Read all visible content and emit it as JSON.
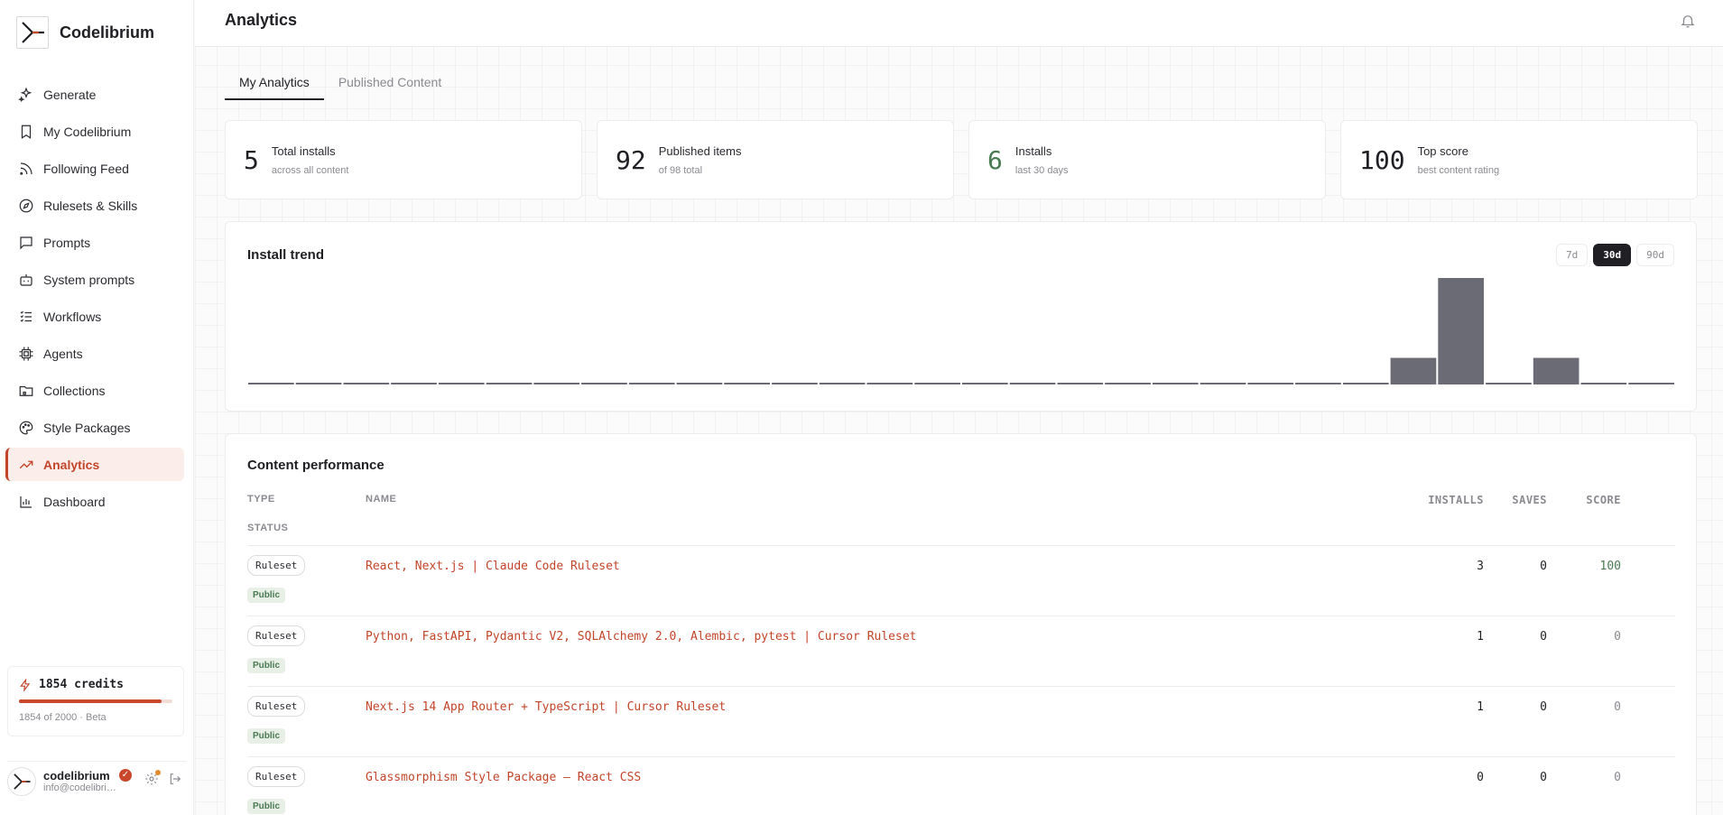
{
  "app": {
    "name": "Codelibrium"
  },
  "sidebar": {
    "items": [
      {
        "label": "Generate",
        "icon": "sparkles-icon"
      },
      {
        "label": "My Codelibrium",
        "icon": "bookmark-icon"
      },
      {
        "label": "Following Feed",
        "icon": "rss-icon"
      },
      {
        "label": "Rulesets & Skills",
        "icon": "compass-icon"
      },
      {
        "label": "Prompts",
        "icon": "message-square-icon"
      },
      {
        "label": "System prompts",
        "icon": "bot-icon"
      },
      {
        "label": "Workflows",
        "icon": "list-checks-icon"
      },
      {
        "label": "Agents",
        "icon": "cpu-icon"
      },
      {
        "label": "Collections",
        "icon": "folder-icon"
      },
      {
        "label": "Style Packages",
        "icon": "palette-icon"
      },
      {
        "label": "Analytics",
        "icon": "trending-up-icon",
        "active": true
      },
      {
        "label": "Dashboard",
        "icon": "bar-chart-icon"
      }
    ],
    "credits": {
      "label": "1854 credits",
      "sub": "1854 of 2000 · Beta",
      "used": 1854,
      "total": 2000
    },
    "user": {
      "name": "codelibrium",
      "email": "info@codelibrium.com"
    }
  },
  "header": {
    "title": "Analytics"
  },
  "tabs": [
    {
      "label": "My Analytics",
      "active": true
    },
    {
      "label": "Published Content",
      "active": false
    }
  ],
  "stats": [
    {
      "value": "5",
      "label": "Total installs",
      "sub": "across all content"
    },
    {
      "value": "92",
      "label": "Published items",
      "sub": "of 98 total"
    },
    {
      "value": "6",
      "label": "Installs",
      "sub": "last 30 days"
    },
    {
      "value": "100",
      "label": "Top score",
      "sub": "best content rating"
    }
  ],
  "trend": {
    "title": "Install trend",
    "ranges": [
      "7d",
      "30d",
      "90d"
    ],
    "active_range": "30d"
  },
  "chart_data": {
    "type": "bar",
    "title": "Install trend",
    "xlabel": "",
    "ylabel": "",
    "values": [
      0,
      0,
      0,
      0,
      0,
      0,
      0,
      0,
      0,
      0,
      0,
      0,
      0,
      0,
      0,
      0,
      0,
      0,
      0,
      0,
      0,
      0,
      0,
      0,
      1,
      4,
      0,
      1,
      0,
      0
    ],
    "ylim": [
      0,
      4
    ],
    "color": "#6b6b76"
  },
  "performance": {
    "title": "Content performance",
    "columns": {
      "type": "TYPE",
      "name": "NAME",
      "installs": "INSTALLS",
      "saves": "SAVES",
      "score": "SCORE",
      "status": "STATUS"
    },
    "rows": [
      {
        "type": "Ruleset",
        "status": "Public",
        "name": "React, Next.js | Claude Code Ruleset",
        "installs": "3",
        "saves": "0",
        "score": "100"
      },
      {
        "type": "Ruleset",
        "status": "Public",
        "name": "Python, FastAPI, Pydantic V2, SQLAlchemy 2.0, Alembic, pytest | Cursor Ruleset",
        "installs": "1",
        "saves": "0",
        "score": "0"
      },
      {
        "type": "Ruleset",
        "status": "Public",
        "name": "Next.js 14 App Router + TypeScript | Cursor Ruleset",
        "installs": "1",
        "saves": "0",
        "score": "0"
      },
      {
        "type": "Ruleset",
        "status": "Public",
        "name": "Glassmorphism Style Package — React CSS",
        "installs": "0",
        "saves": "0",
        "score": "0"
      }
    ]
  },
  "colors": {
    "accent": "#c2452a",
    "positive": "#4a7a52"
  }
}
